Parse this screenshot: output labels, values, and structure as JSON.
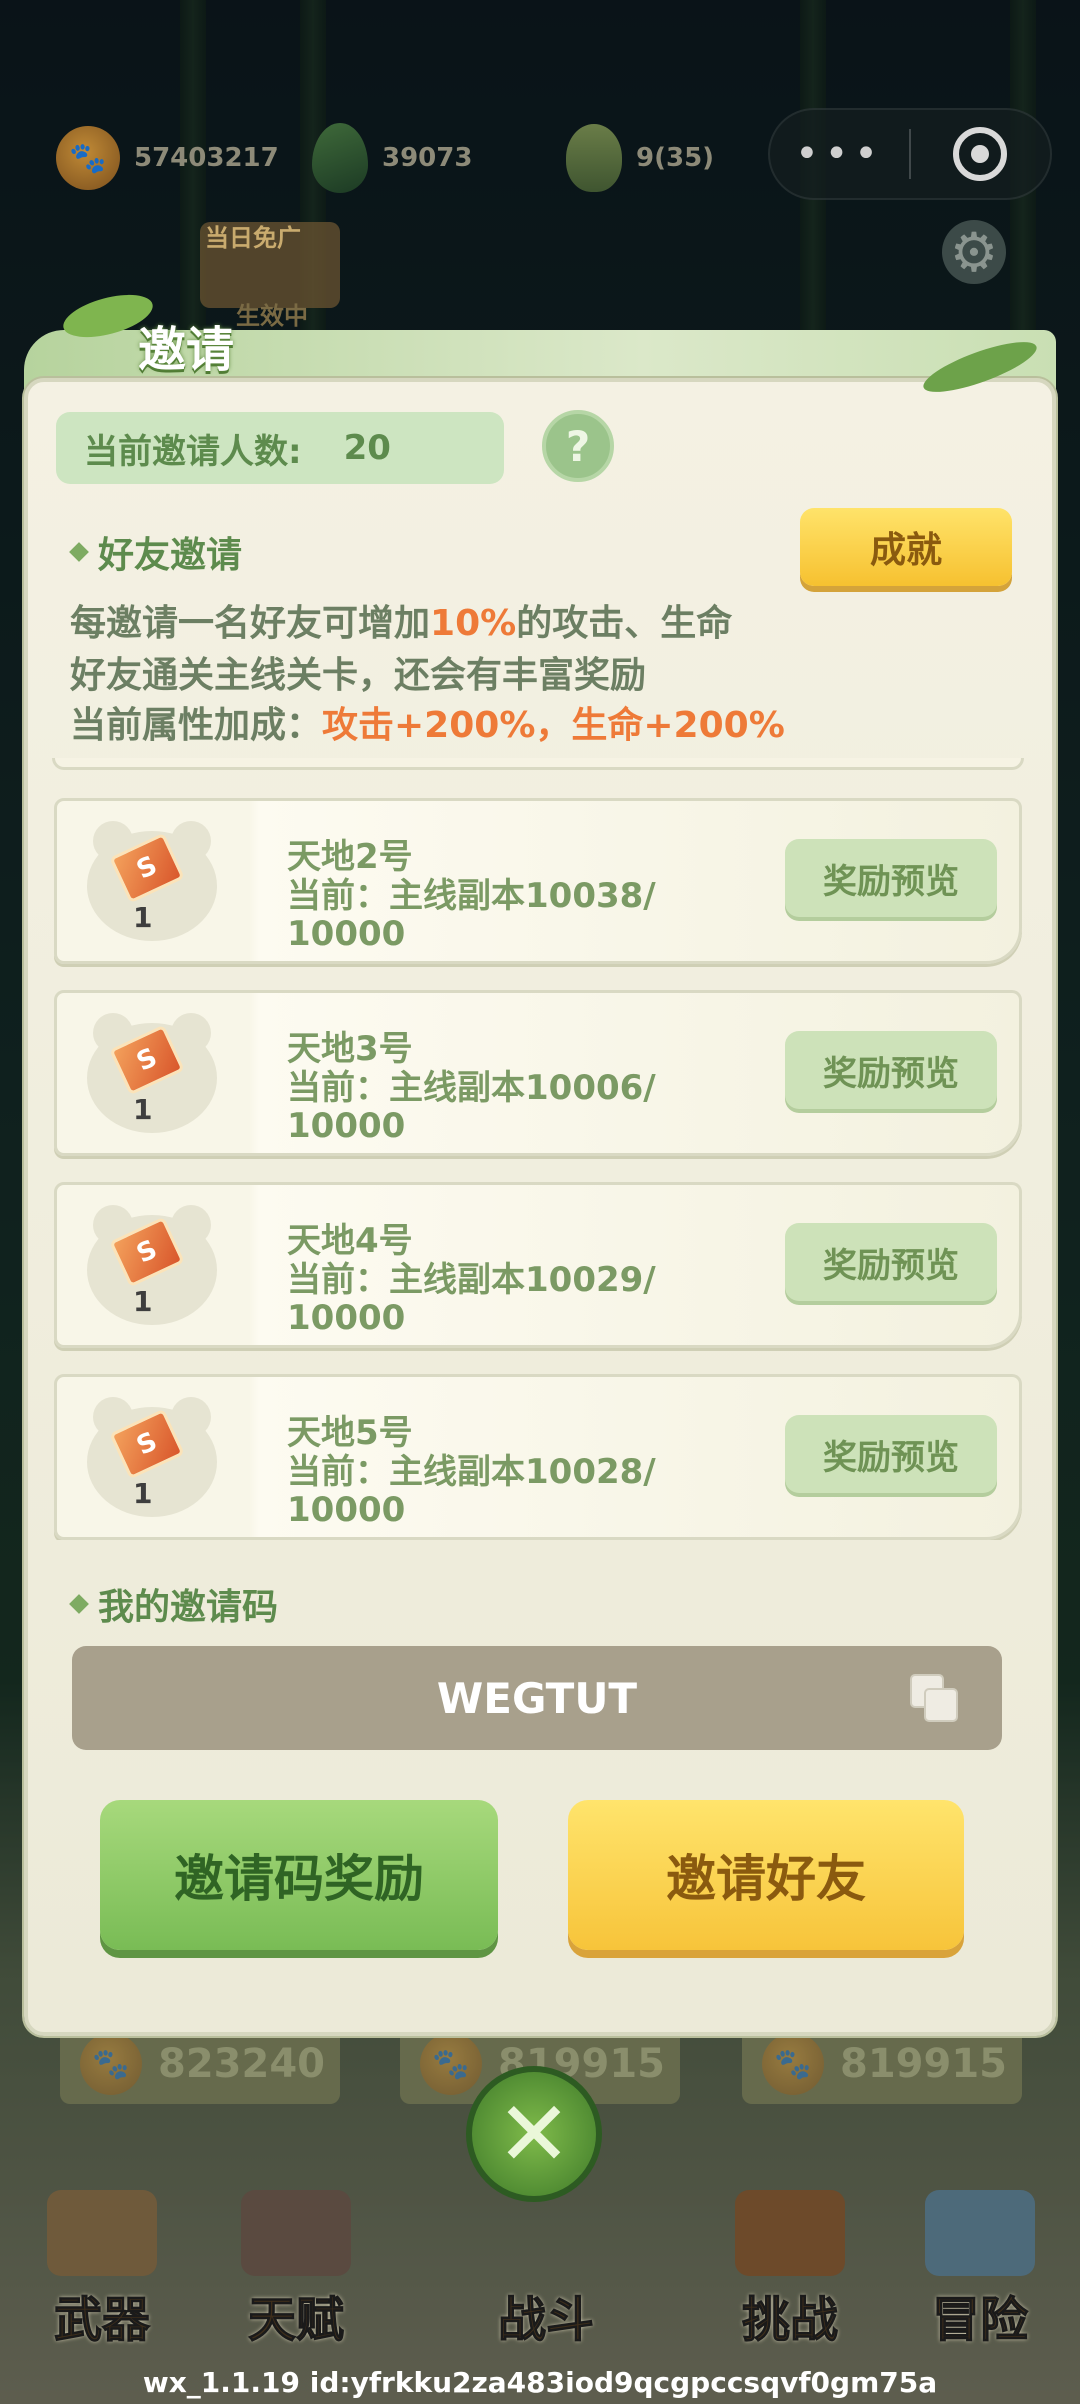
{
  "hud": {
    "paw_coins": "57403217",
    "leaves": "39073",
    "buds": "9(35)",
    "more_label": "•••",
    "daily_label": "当日免广",
    "daily_status": "生效中"
  },
  "panel": {
    "title": "邀请",
    "invite_count_label": "当前邀请人数:",
    "invite_count_value": "20",
    "help_label": "?",
    "friends_section": "好友邀请",
    "achievement_button": "成就",
    "desc_line1_a": "每邀请一名好友可增加",
    "desc_line1_pct": "10%",
    "desc_line1_b": "的攻击、生命",
    "desc_line2": "好友通关主线关卡，还会有丰富奖励",
    "desc_line3_a": "当前属性加成：",
    "desc_line3_b": "攻击+200%，生命+200%",
    "friends": [
      {
        "name": "天地2号",
        "progress": "当前：主线副本10038/ 10000",
        "qty": "1",
        "button": "奖励预览"
      },
      {
        "name": "天地3号",
        "progress": "当前：主线副本10006/ 10000",
        "qty": "1",
        "button": "奖励预览"
      },
      {
        "name": "天地4号",
        "progress": "当前：主线副本10029/ 10000",
        "qty": "1",
        "button": "奖励预览"
      },
      {
        "name": "天地5号",
        "progress": "当前：主线副本10028/ 10000",
        "qty": "1",
        "button": "奖励预览"
      }
    ],
    "code_section": "我的邀请码",
    "invite_code": "WEGTUT",
    "code_reward_button": "邀请码奖励",
    "invite_friend_button": "邀请好友"
  },
  "bottom_counts": [
    "823240",
    "819915",
    "819915"
  ],
  "nav": {
    "weapon": "武器",
    "talent": "天赋",
    "battle": "战斗",
    "challenge": "挑战",
    "adventure": "冒险"
  },
  "version": "wx_1.1.19 id:yfrkku2za483iod9qcgpccsqvf0gm75a",
  "colors": {
    "accent_green": "#79bc55",
    "accent_yellow": "#f7c43a",
    "highlight_orange": "#ee7a38",
    "panel_bg": "#f4f1e3"
  }
}
